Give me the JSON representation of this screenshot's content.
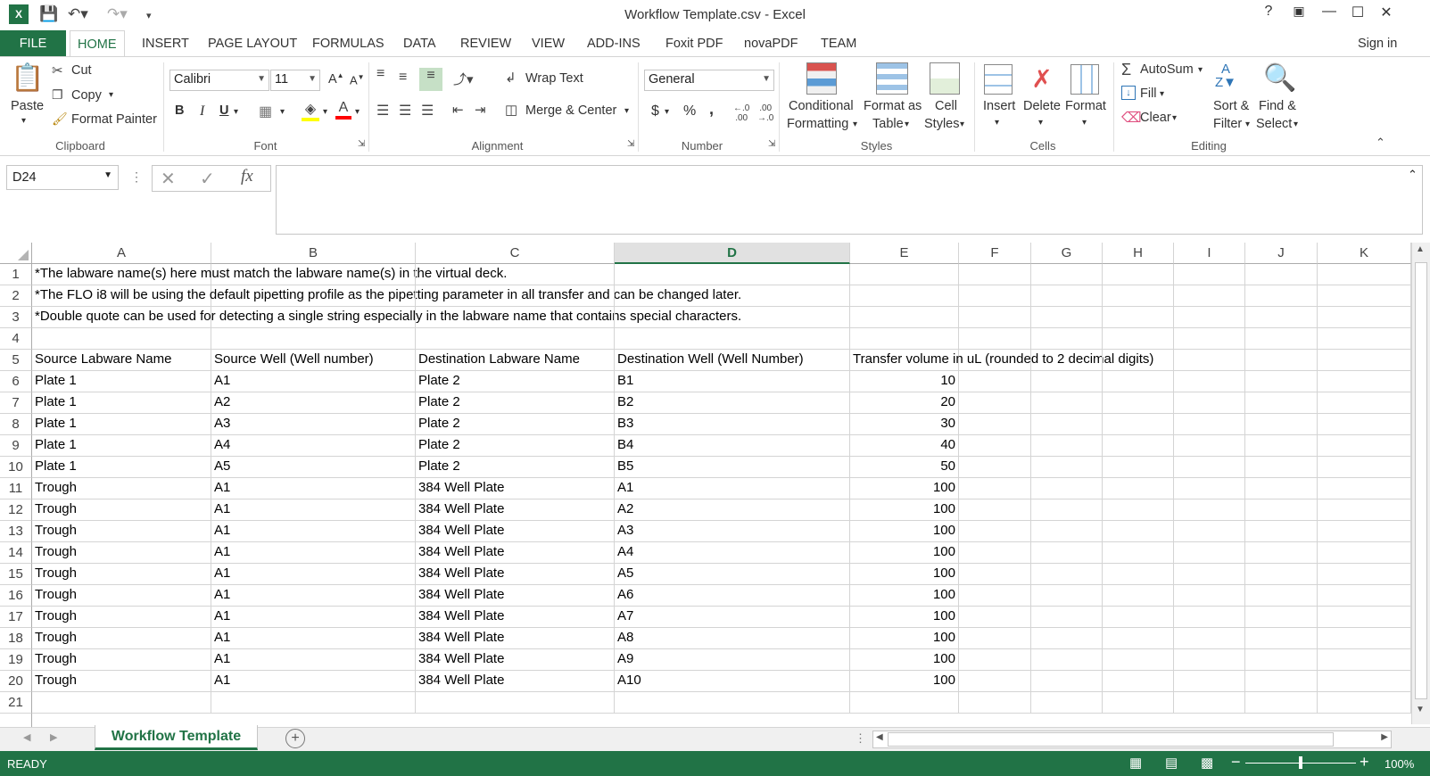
{
  "window": {
    "title": "Workflow Template.csv - Excel",
    "help": "?",
    "sign_in": "Sign in"
  },
  "tabs": [
    "FILE",
    "HOME",
    "INSERT",
    "PAGE LAYOUT",
    "FORMULAS",
    "DATA",
    "REVIEW",
    "VIEW",
    "ADD-INS",
    "Foxit PDF",
    "novaPDF",
    "TEAM"
  ],
  "ribbon": {
    "clipboard": {
      "label": "Clipboard",
      "paste": "Paste",
      "cut": "Cut",
      "copy": "Copy",
      "format_painter": "Format Painter"
    },
    "font": {
      "label": "Font",
      "name": "Calibri",
      "size": "11",
      "bold": "B",
      "italic": "I",
      "underline": "U"
    },
    "alignment": {
      "label": "Alignment",
      "wrap_text": "Wrap Text",
      "merge_center": "Merge & Center"
    },
    "number": {
      "label": "Number",
      "format": "General",
      "currency": "$",
      "percent": "%",
      "comma": ","
    },
    "styles": {
      "label": "Styles",
      "conditional_1": "Conditional",
      "conditional_2": "Formatting",
      "format_as_1": "Format as",
      "format_as_2": "Table",
      "cell_styles_1": "Cell",
      "cell_styles_2": "Styles"
    },
    "cells": {
      "label": "Cells",
      "insert": "Insert",
      "delete": "Delete",
      "format": "Format"
    },
    "editing": {
      "label": "Editing",
      "autosum": "AutoSum",
      "fill": "Fill",
      "clear": "Clear",
      "sort_1": "Sort &",
      "sort_2": "Filter",
      "find_1": "Find &",
      "find_2": "Select"
    }
  },
  "formula_bar": {
    "name_box": "D24",
    "fx": "fx",
    "value": ""
  },
  "columns": [
    "A",
    "B",
    "C",
    "D",
    "E",
    "F",
    "G",
    "H",
    "I",
    "J",
    "K"
  ],
  "selected_column": "D",
  "rows": [
    {
      "n": "1",
      "a": "*The labware name(s) here must match the labware name(s) in the virtual deck.",
      "b": "",
      "c": "",
      "d": "",
      "e": ""
    },
    {
      "n": "2",
      "a": "*The FLO i8 will be using the default pipetting profile as the pipetting parameter in all transfer and can be changed later.",
      "b": "",
      "c": "",
      "d": "",
      "e": ""
    },
    {
      "n": "3",
      "a": "*Double quote can be used for detecting a single string especially in the labware name that contains special characters.",
      "b": "",
      "c": "",
      "d": "",
      "e": ""
    },
    {
      "n": "4",
      "a": "",
      "b": "",
      "c": "",
      "d": "",
      "e": ""
    },
    {
      "n": "5",
      "a": "Source Labware Name",
      "b": "Source Well (Well number)",
      "c": "Destination Labware Name",
      "d": "Destination Well (Well Number)",
      "e": "Transfer volume in uL (rounded to 2 decimal digits)"
    },
    {
      "n": "6",
      "a": "Plate 1",
      "b": "A1",
      "c": "Plate 2",
      "d": "B1",
      "e": "10"
    },
    {
      "n": "7",
      "a": "Plate 1",
      "b": "A2",
      "c": "Plate 2",
      "d": "B2",
      "e": "20"
    },
    {
      "n": "8",
      "a": "Plate 1",
      "b": "A3",
      "c": "Plate 2",
      "d": "B3",
      "e": "30"
    },
    {
      "n": "9",
      "a": "Plate 1",
      "b": "A4",
      "c": "Plate 2",
      "d": "B4",
      "e": "40"
    },
    {
      "n": "10",
      "a": "Plate 1",
      "b": "A5",
      "c": "Plate 2",
      "d": "B5",
      "e": "50"
    },
    {
      "n": "11",
      "a": "Trough",
      "b": "A1",
      "c": "384 Well Plate",
      "d": "A1",
      "e": "100"
    },
    {
      "n": "12",
      "a": "Trough",
      "b": "A1",
      "c": "384 Well Plate",
      "d": "A2",
      "e": "100"
    },
    {
      "n": "13",
      "a": "Trough",
      "b": "A1",
      "c": "384 Well Plate",
      "d": "A3",
      "e": "100"
    },
    {
      "n": "14",
      "a": "Trough",
      "b": "A1",
      "c": "384 Well Plate",
      "d": "A4",
      "e": "100"
    },
    {
      "n": "15",
      "a": "Trough",
      "b": "A1",
      "c": "384 Well Plate",
      "d": "A5",
      "e": "100"
    },
    {
      "n": "16",
      "a": "Trough",
      "b": "A1",
      "c": "384 Well Plate",
      "d": "A6",
      "e": "100"
    },
    {
      "n": "17",
      "a": "Trough",
      "b": "A1",
      "c": "384 Well Plate",
      "d": "A7",
      "e": "100"
    },
    {
      "n": "18",
      "a": "Trough",
      "b": "A1",
      "c": "384 Well Plate",
      "d": "A8",
      "e": "100"
    },
    {
      "n": "19",
      "a": "Trough",
      "b": "A1",
      "c": "384 Well Plate",
      "d": "A9",
      "e": "100"
    },
    {
      "n": "20",
      "a": "Trough",
      "b": "A1",
      "c": "384 Well Plate",
      "d": "A10",
      "e": "100"
    },
    {
      "n": "21",
      "a": "",
      "b": "",
      "c": "",
      "d": "",
      "e": ""
    }
  ],
  "sheet_tab": "Workflow Template",
  "status": {
    "mode": "READY",
    "zoom": "100%"
  },
  "colors": {
    "accent": "#217346"
  }
}
